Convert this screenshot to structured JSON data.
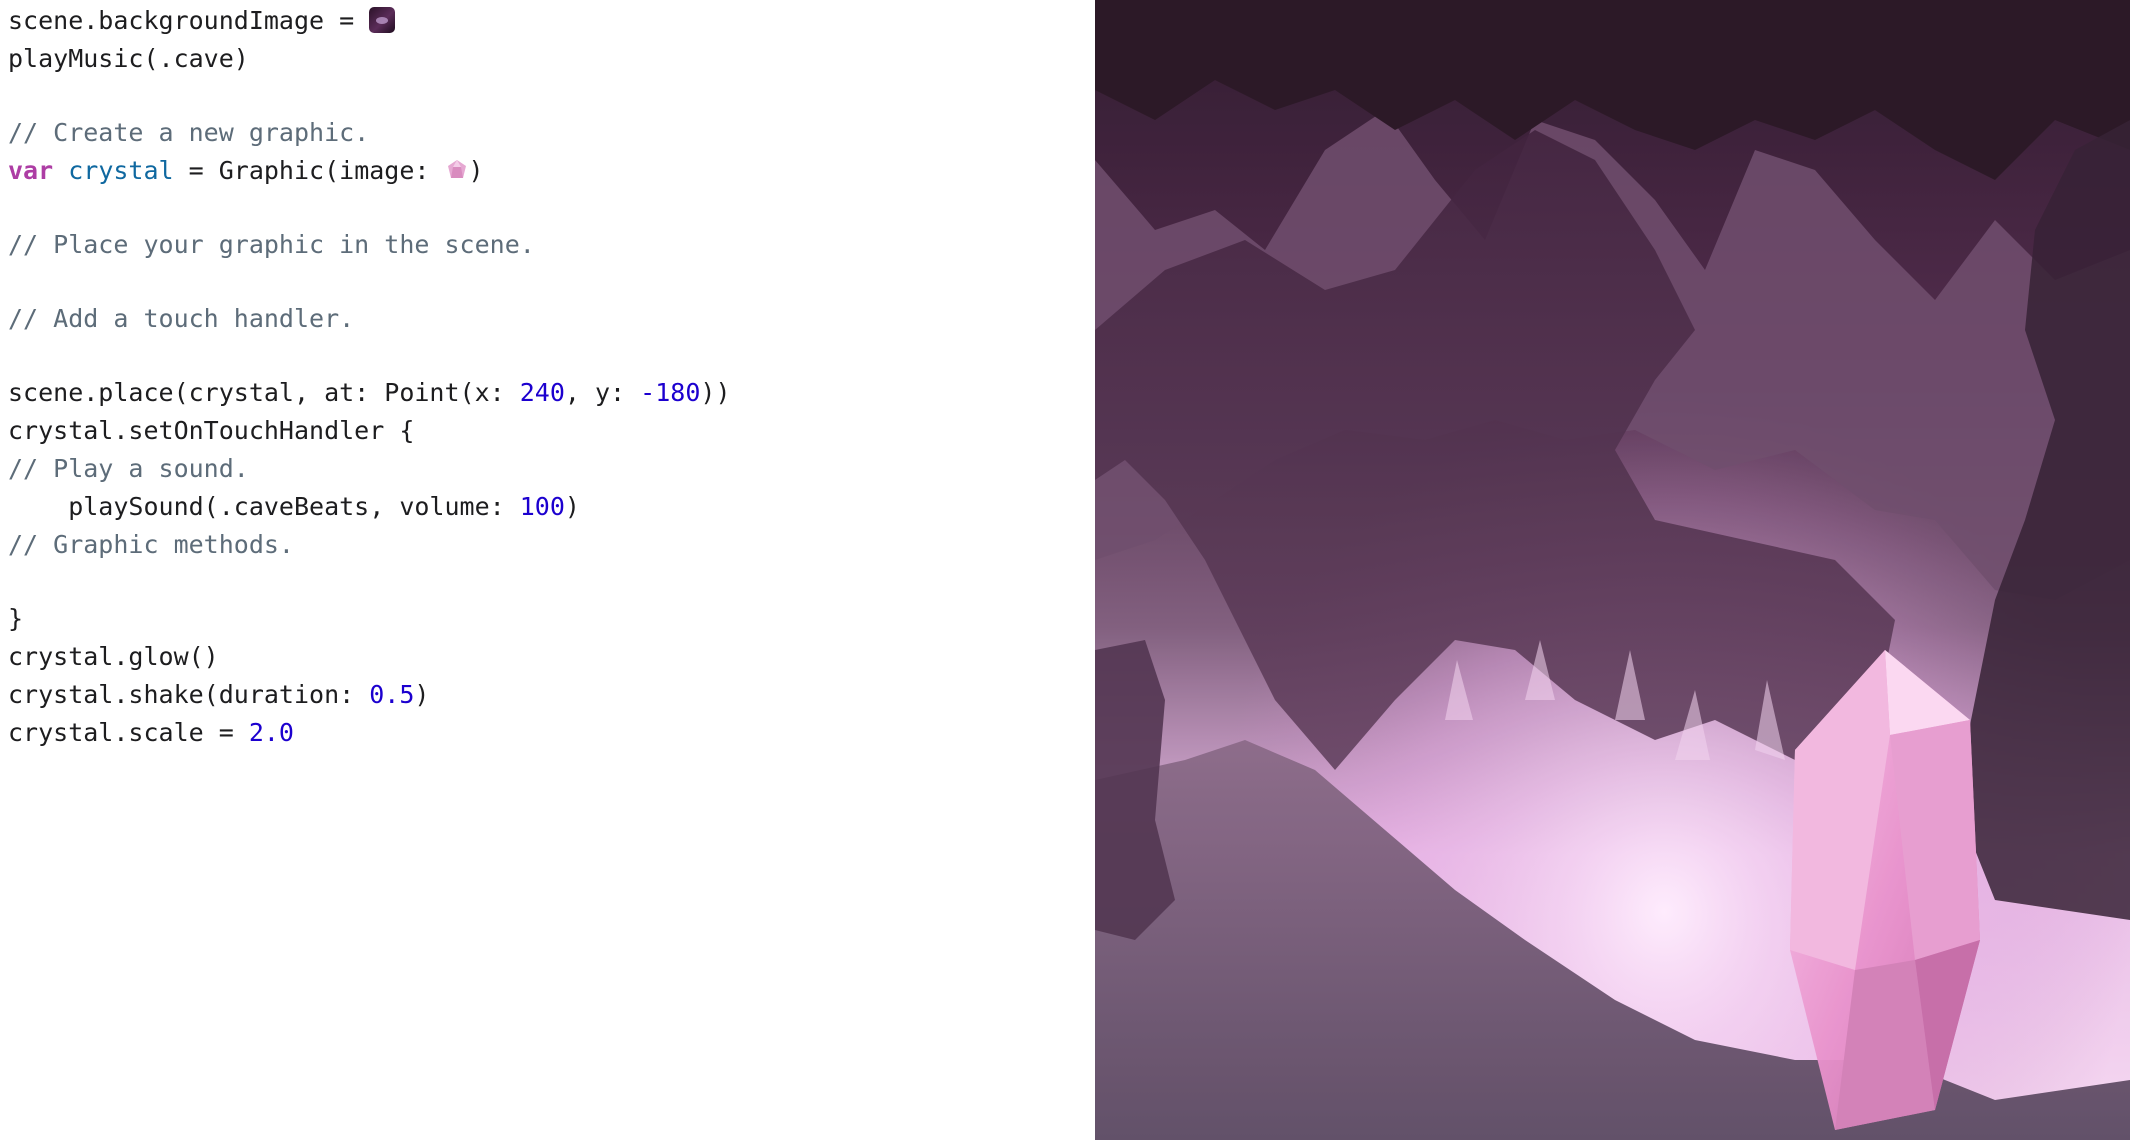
{
  "editor": {
    "lines": {
      "l1": {
        "text": "scene.backgroundImage = ",
        "icon": "cave-background-image-literal"
      },
      "l2": {
        "text": "playMusic(.cave)"
      },
      "l3": {
        "text": "// Create a new graphic."
      },
      "l4": {
        "keyword": "var",
        "identifier": "crystal",
        "text": " = Graphic(image: ",
        "icon": "crystal-image-literal",
        "close": ")"
      },
      "l5": {
        "text": "// Place your graphic in the scene."
      },
      "l6": {
        "text": "// Add a touch handler."
      },
      "l7": {
        "a": "scene.place(crystal, at: Point(x: ",
        "x": "240",
        "b": ", y: ",
        "y": "-180",
        "c": "))"
      },
      "l8": {
        "text": "crystal.setOnTouchHandler {"
      },
      "l9": {
        "text": "// Play a sound."
      },
      "l10": {
        "a": "    playSound(.caveBeats, volume: ",
        "volume": "100",
        "c": ")"
      },
      "l11": {
        "text": "// Graphic methods."
      },
      "l12": {
        "text": "}"
      },
      "l13": {
        "text": "crystal.glow()"
      },
      "l14": {
        "a": "crystal.shake(duration: ",
        "duration": "0.5",
        "c": ")"
      },
      "l15": {
        "a": "crystal.scale = ",
        "scale": "2.0"
      }
    }
  },
  "colors": {
    "keyword": "#ad3da4",
    "identifier": "#0f68a0",
    "number": "#1c00cf",
    "comment": "#5d6c79",
    "text": "#1d1d1f"
  },
  "scene": {
    "background": "cave-scene",
    "graphic": "pink-crystal"
  }
}
